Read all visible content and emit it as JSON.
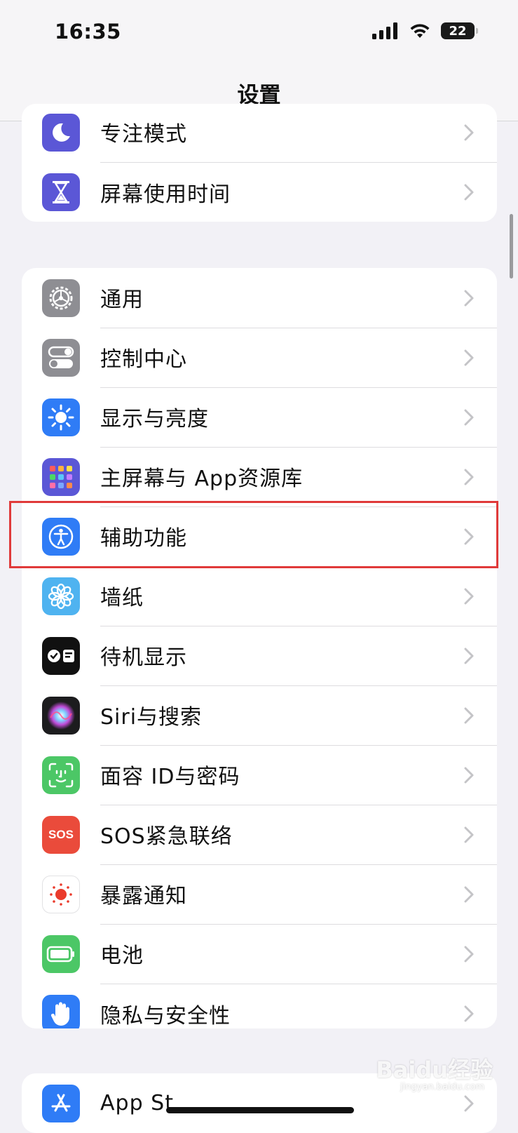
{
  "status_bar": {
    "time": "16:35",
    "battery": "22"
  },
  "nav": {
    "title": "设置"
  },
  "groups": [
    {
      "items": [
        {
          "label": "专注模式",
          "icon": "moon-icon",
          "color": "#5b57d6"
        },
        {
          "label": "屏幕使用时间",
          "icon": "hourglass-icon",
          "color": "#5b57d6"
        }
      ]
    },
    {
      "items": [
        {
          "label": "通用",
          "icon": "gear-icon",
          "color": "#8e8e93"
        },
        {
          "label": "控制中心",
          "icon": "toggles-icon",
          "color": "#8e8e93"
        },
        {
          "label": "显示与亮度",
          "icon": "sun-icon",
          "color": "#2f7cf6"
        },
        {
          "label": "主屏幕与 App资源库",
          "icon": "app-grid-icon",
          "color": "#5b57d6"
        },
        {
          "label": "辅助功能",
          "icon": "accessibility-icon",
          "color": "#2f7cf6"
        },
        {
          "label": "墙纸",
          "icon": "flower-icon",
          "color": "#4fb3f0"
        },
        {
          "label": "待机显示",
          "icon": "standby-icon",
          "color": "#111111"
        },
        {
          "label": "Siri与搜索",
          "icon": "siri-icon",
          "color": "#1c1c1e"
        },
        {
          "label": "面容 ID与密码",
          "icon": "face-id-icon",
          "color": "#4cc766"
        },
        {
          "label": "SOS紧急联络",
          "icon": "sos-icon",
          "color": "#ea4b3b"
        },
        {
          "label": "暴露通知",
          "icon": "exposure-icon",
          "color": "#ffffff"
        },
        {
          "label": "电池",
          "icon": "battery-icon",
          "color": "#4cc766"
        },
        {
          "label": "隐私与安全性",
          "icon": "hand-icon",
          "color": "#2f7cf6"
        }
      ]
    },
    {
      "items": [
        {
          "label": "App St",
          "icon": "app-store-icon",
          "color": "#2f7cf6"
        }
      ]
    }
  ],
  "sos_text": "SOS",
  "watermark": {
    "text": "Baidu经验",
    "sub": "jingyan.baidu.com"
  },
  "highlight_color": "#e03a3a"
}
